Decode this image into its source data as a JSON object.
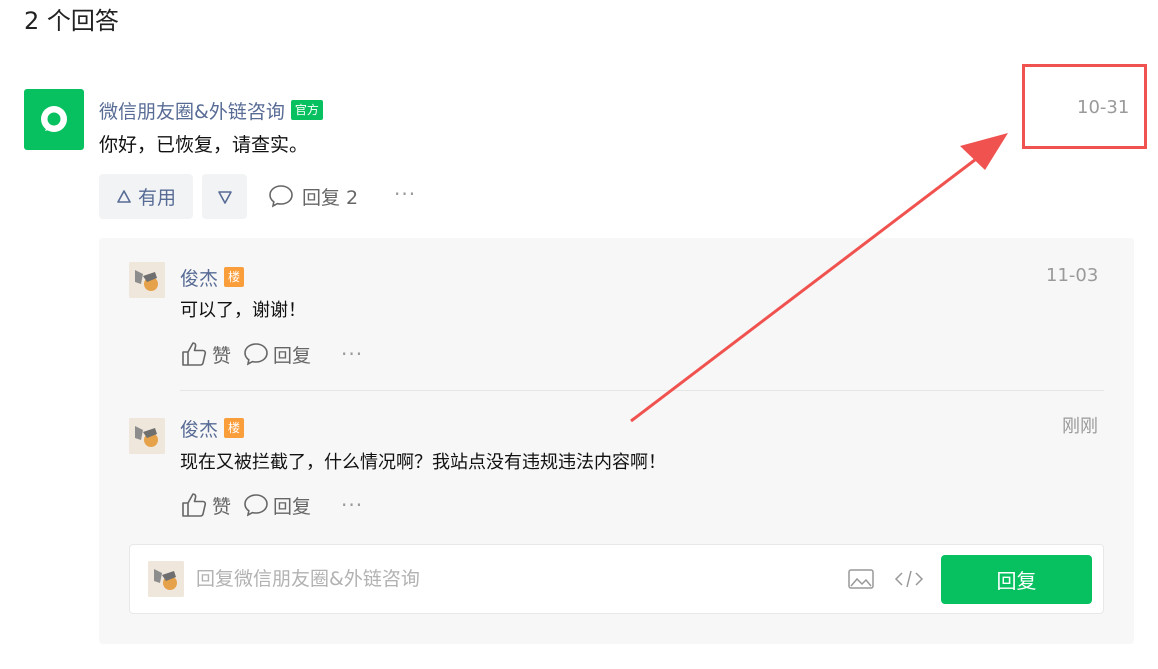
{
  "header": {
    "title": "2 个回答"
  },
  "answer": {
    "author": "微信朋友圈&外链咨询",
    "badge": "官方",
    "text": "你好，已恢复，请查实。",
    "date": "10-31",
    "useful_label": "有用",
    "reply_label": "回复 2"
  },
  "comments": [
    {
      "author": "俊杰",
      "badge": "楼",
      "time": "11-03",
      "text": "可以了，谢谢！",
      "like_label": "赞",
      "reply_label": "回复"
    },
    {
      "author": "俊杰",
      "badge": "楼",
      "time": "刚刚",
      "text": "现在又被拦截了，什么情况啊？我站点没有违规违法内容啊！",
      "like_label": "赞",
      "reply_label": "回复"
    }
  ],
  "reply_box": {
    "placeholder": "回复微信朋友圈&外链咨询",
    "submit_label": "回复"
  },
  "colors": {
    "brand": "#07c160",
    "link": "#576b95",
    "badge_floor": "#fa9d3b",
    "annotation": "#f0534f"
  },
  "icons": [
    "wechat-logo-icon",
    "upvote-icon",
    "downvote-icon",
    "comment-icon",
    "more-icon",
    "thumb-up-icon",
    "image-icon",
    "code-icon",
    "user-avatar-icon"
  ]
}
